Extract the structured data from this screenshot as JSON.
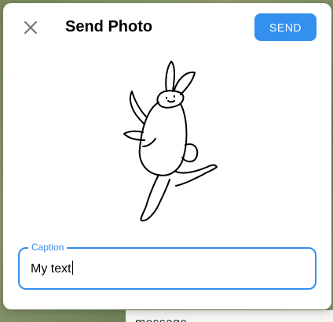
{
  "dialog": {
    "title": "Send Photo",
    "send_label": "SEND",
    "close_icon": "close-icon",
    "photo_subject": "dancing rabbit sticker",
    "caption": {
      "label": "Caption",
      "value": "My text"
    }
  },
  "background": {
    "peek_text": "message"
  },
  "colors": {
    "accent": "#3390ec",
    "dialog_bg": "#ffffff",
    "title_text": "#000000"
  }
}
